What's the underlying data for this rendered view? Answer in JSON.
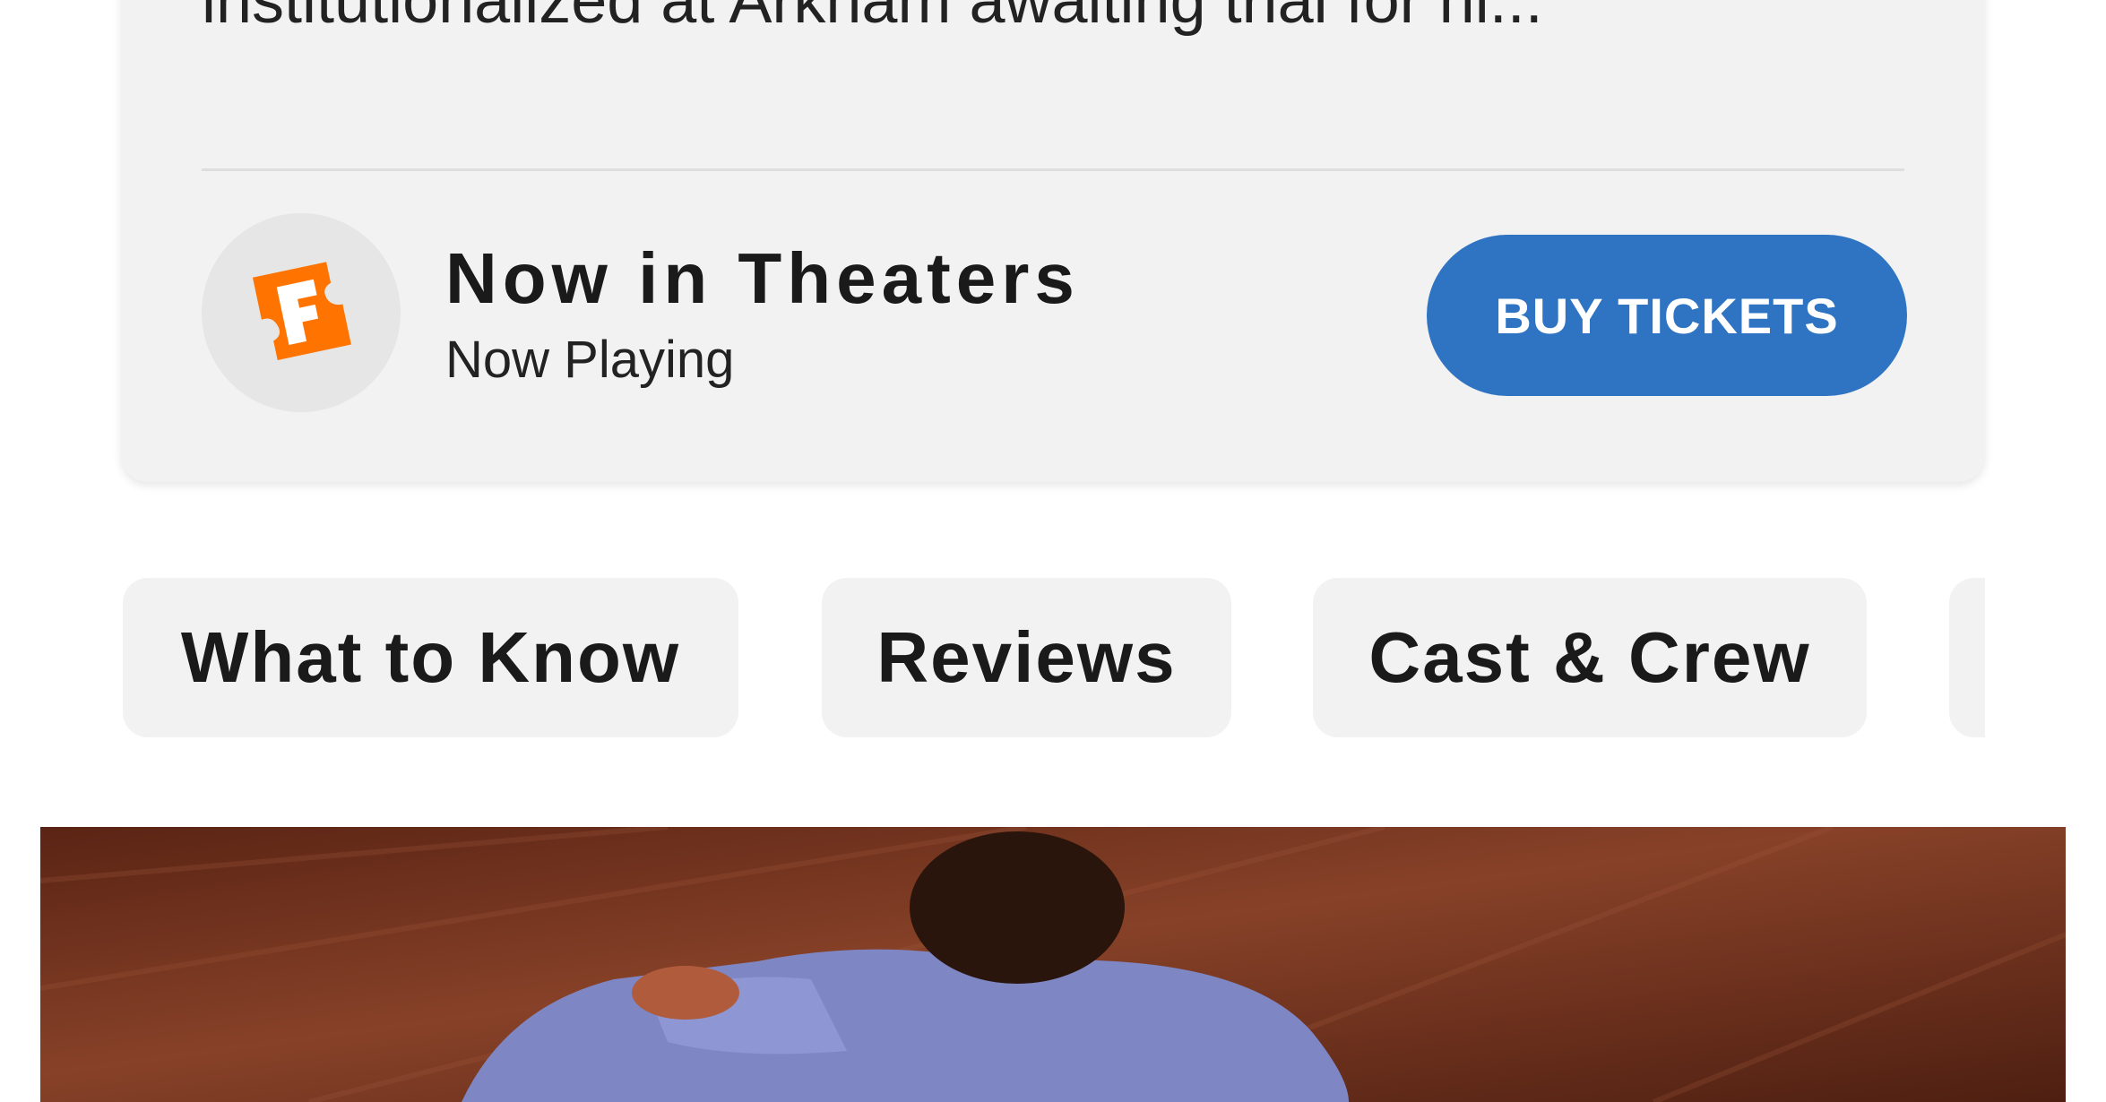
{
  "card": {
    "synopsis": "institutionalized at Arkham awaiting trial for hi...",
    "theaters": {
      "title": "Now in Theaters",
      "subtitle": "Now Playing",
      "logo_icon": "fandango-logo-icon",
      "logo_color": "#ff7300"
    },
    "buy_button": {
      "label": "BUY TICKETS",
      "color": "#2f74c3"
    }
  },
  "tabs": [
    {
      "label": "What to Know"
    },
    {
      "label": "Reviews"
    },
    {
      "label": "Cast & Crew"
    },
    {
      "label": ""
    }
  ]
}
